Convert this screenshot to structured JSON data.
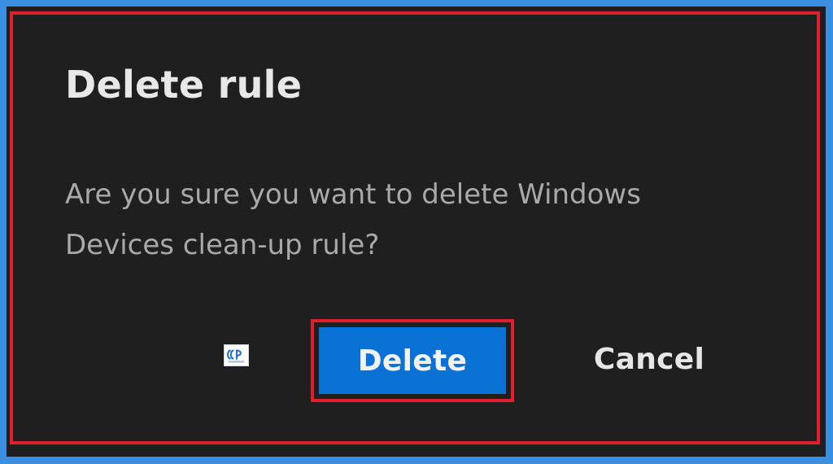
{
  "dialog": {
    "title": "Delete rule",
    "message": "Are you sure you want to delete Windows Devices clean-up rule?",
    "delete_label": "Delete",
    "cancel_label": "Cancel"
  },
  "colors": {
    "background_frame": "#3a8fe0",
    "dialog_background": "#1f1f1f",
    "highlight_border": "#e0202f",
    "primary_button": "#0a72d4",
    "title_text": "#e8e8e8",
    "message_text": "#a9a9a9"
  },
  "watermark": {
    "icon": "logo-icon"
  }
}
